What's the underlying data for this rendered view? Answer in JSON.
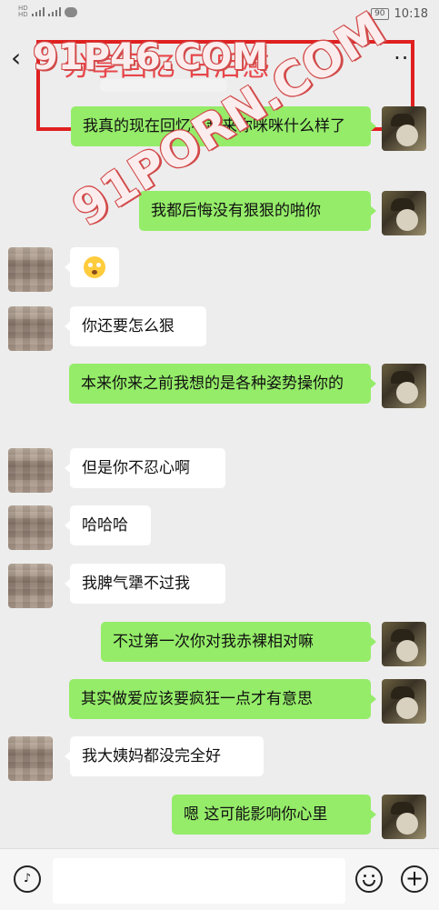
{
  "status_bar": {
    "hd1": "HD",
    "hd2": "HD",
    "battery": "90",
    "time": "10:18"
  },
  "header": {
    "back_icon": "chevron-left-icon",
    "title": "分享回忆 日后感",
    "more": "···"
  },
  "watermarks": [
    "91P46.COM",
    "91PORN.COM"
  ],
  "messages": [
    {
      "side": "right",
      "text": "我真的现在回忆不起来你咪咪什么样了"
    },
    {
      "side": "right",
      "text": "我都后悔没有狠狠的啪你"
    },
    {
      "side": "left",
      "text": "",
      "emoji": "flushed-face-icon"
    },
    {
      "side": "left",
      "text": "你还要怎么狠"
    },
    {
      "side": "right",
      "text": "本来你来之前我想的是各种姿势操你的"
    },
    {
      "side": "left",
      "text": "但是你不忍心啊"
    },
    {
      "side": "left",
      "text": "哈哈哈"
    },
    {
      "side": "left",
      "text": "我脾气犟不过我"
    },
    {
      "side": "right",
      "text": "不过第一次你对我赤裸相对嘛"
    },
    {
      "side": "right",
      "text": "其实做爱应该要疯狂一点才有意思"
    },
    {
      "side": "left",
      "text": "我大姨妈都没完全好"
    },
    {
      "side": "right",
      "text": "嗯 这可能影响你心里"
    }
  ],
  "input_bar": {
    "voice_icon": "voice-icon",
    "emoji_icon": "emoji-icon",
    "plus_icon": "plus-icon",
    "placeholder": ""
  },
  "colors": {
    "sent_bubble": "#95ec69",
    "received_bubble": "#ffffff",
    "background": "#ededed",
    "watermark": "#d24a4a"
  }
}
